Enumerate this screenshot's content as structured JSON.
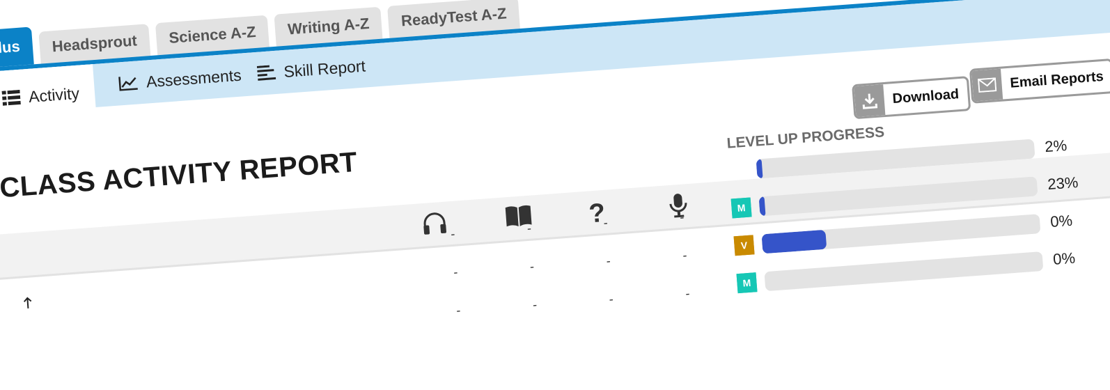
{
  "product_tabs": [
    {
      "label": "z-Plus",
      "active": true
    },
    {
      "label": "Headsprout",
      "active": false
    },
    {
      "label": "Science A-Z",
      "active": false
    },
    {
      "label": "Writing A-Z",
      "active": false
    },
    {
      "label": "ReadyTest A-Z",
      "active": false
    }
  ],
  "sub_tabs": {
    "activity": "Activity",
    "assessments": "Assessments",
    "skill_report": "Skill Report"
  },
  "actions": {
    "download": "Download",
    "email_reports": "Email Reports"
  },
  "report": {
    "title": "S CLASS ACTIVITY REPORT",
    "level_up_header": "LEVEL UP PROGRESS",
    "column_icons": [
      "headphones-icon",
      "book-icon",
      "question-icon",
      "microphone-icon"
    ]
  },
  "rows": [
    {
      "level": "",
      "level_color": "",
      "progress": 0.02,
      "percent": "2%",
      "cells": []
    },
    {
      "level": "M",
      "level_color": "#16c7b5",
      "progress": 0.02,
      "percent": "23%",
      "cells": [
        "-",
        "-",
        "-",
        "-"
      ]
    },
    {
      "level": "V",
      "level_color": "#c98a00",
      "progress": 0.23,
      "percent": "0%",
      "cells": [
        "-",
        "-",
        "-",
        "-"
      ]
    },
    {
      "level": "M",
      "level_color": "#16c7b5",
      "progress": 0.0,
      "percent": "0%",
      "cells": [
        "-",
        "-",
        "-",
        "-"
      ]
    }
  ],
  "colors": {
    "accent_blue": "#0b82c7",
    "subnav_bg": "#cde6f6",
    "bar_fill": "#3554c9",
    "bar_track": "#e3e3e3"
  }
}
